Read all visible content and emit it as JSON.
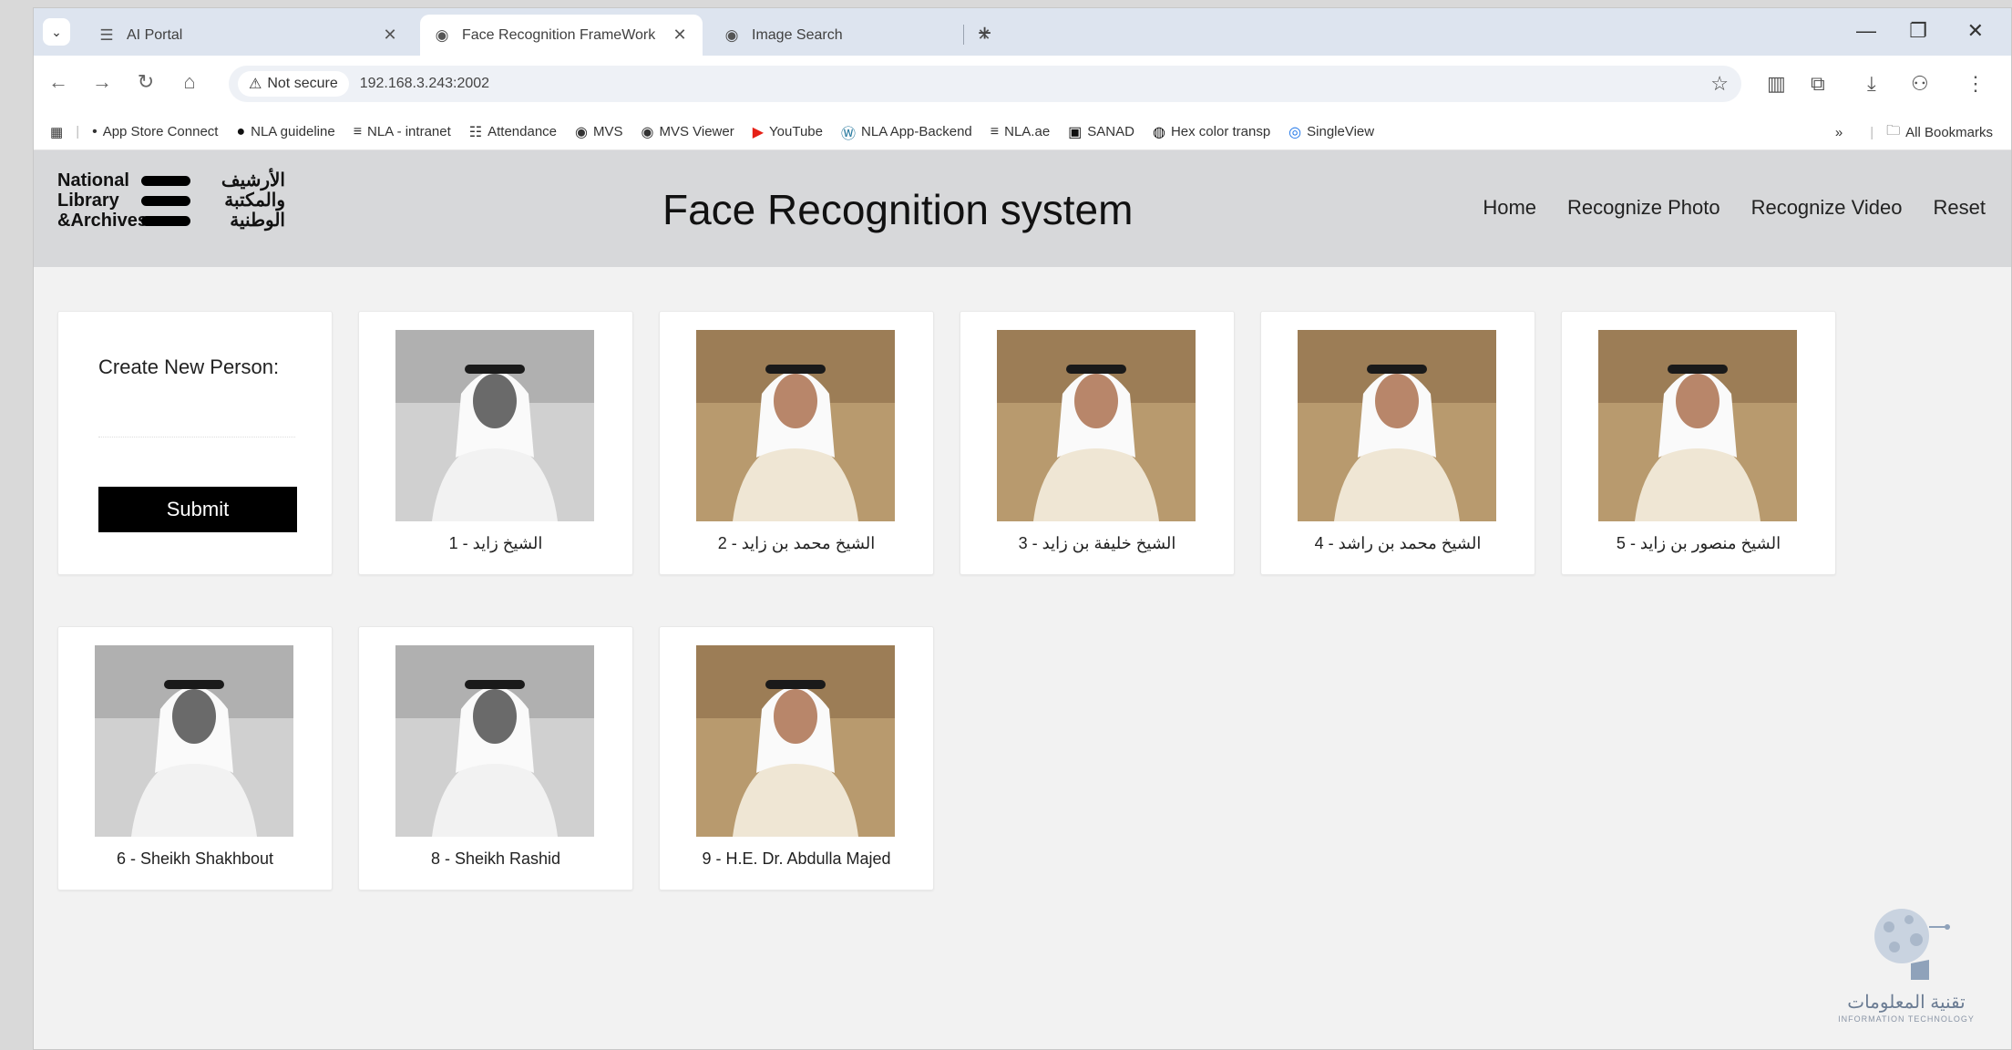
{
  "browser": {
    "tabs": [
      {
        "label": "AI Portal",
        "icon": "ai-portal-icon",
        "active": false
      },
      {
        "label": "Face Recognition FrameWork",
        "icon": "globe-icon",
        "active": true
      },
      {
        "label": "Image Search",
        "icon": "globe-icon",
        "active": false
      }
    ],
    "address": {
      "security_label": "Not secure",
      "url": "192.168.3.243:2002"
    },
    "bookmarks": [
      {
        "label": "App Store Connect",
        "icon": "apple-icon"
      },
      {
        "label": "NLA guideline",
        "icon": "circle-icon"
      },
      {
        "label": "NLA - intranet",
        "icon": "nla-icon"
      },
      {
        "label": "Attendance",
        "icon": "list-icon"
      },
      {
        "label": "MVS",
        "icon": "globe-icon"
      },
      {
        "label": "MVS Viewer",
        "icon": "globe-icon"
      },
      {
        "label": "YouTube",
        "icon": "youtube-icon"
      },
      {
        "label": "NLA App-Backend",
        "icon": "wordpress-icon"
      },
      {
        "label": "NLA.ae",
        "icon": "nla-icon"
      },
      {
        "label": "SANAD",
        "icon": "sanad-icon"
      },
      {
        "label": "Hex color transp",
        "icon": "github-icon"
      },
      {
        "label": "SingleView",
        "icon": "singleview-icon"
      }
    ],
    "all_bookmarks_label": "All Bookmarks",
    "overflow_label": "»"
  },
  "site": {
    "logo": {
      "en_lines": [
        "National",
        "Library",
        "&Archives"
      ],
      "ar_lines": [
        "الأرشيف",
        "والمكتبة",
        "الوطنية"
      ]
    },
    "title": "Face Recognition system",
    "nav": [
      "Home",
      "Recognize Photo",
      "Recognize Video",
      "Reset"
    ]
  },
  "create_person": {
    "label": "Create New Person:",
    "input_value": "",
    "submit_label": "Submit"
  },
  "persons": [
    {
      "caption": "الشيخ زايد - 1",
      "bw": true
    },
    {
      "caption": "الشيخ محمد بن زايد - 2",
      "bw": false
    },
    {
      "caption": "الشيخ خليفة بن زايد - 3",
      "bw": false
    },
    {
      "caption": "الشيخ محمد بن راشد - 4",
      "bw": false
    },
    {
      "caption": "الشيخ منصور بن زايد - 5",
      "bw": false
    },
    {
      "caption": "6 - Sheikh Shakhbout",
      "bw": true
    },
    {
      "caption": "8 - Sheikh Rashid",
      "bw": true
    },
    {
      "caption": "9 - H.E. Dr. Abdulla Majed",
      "bw": false
    }
  ],
  "watermark": {
    "ar": "تقنية المعلومات",
    "en": "INFORMATION TECHNOLOGY"
  },
  "colors": {
    "header_bg": "#d7d8da",
    "page_bg": "#f2f2f2",
    "submit_bg": "#000000",
    "tabstrip_bg": "#dde4ef"
  }
}
